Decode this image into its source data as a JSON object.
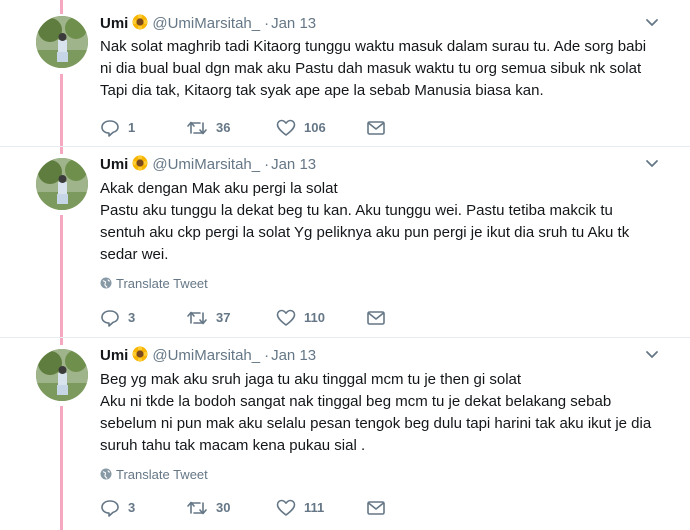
{
  "tweets": [
    {
      "name": "Umi",
      "handle": "@UmiMarsitah_",
      "sep": "·",
      "time": "Jan 13",
      "lines": [
        "Nak solat maghrib tadi Kitaorg tunggu waktu masuk dalam surau tu. Ade sorg babi ni dia bual bual dgn mak aku Pastu dah masuk waktu tu org semua sibuk nk solat Tapi dia tak, Kitaorg tak syak ape ape la sebab Manusia biasa kan."
      ],
      "translate": "",
      "replies": "1",
      "retweets": "36",
      "likes": "106"
    },
    {
      "name": "Umi",
      "handle": "@UmiMarsitah_",
      "sep": "·",
      "time": "Jan 13",
      "lines": [
        "Akak dengan Mak aku pergi la solat",
        "Pastu aku tunggu la dekat beg tu kan. Aku tunggu wei. Pastu tetiba makcik tu sentuh aku ckp pergi la solat Yg peliknya aku pun pergi je ikut dia sruh tu Aku tk sedar wei."
      ],
      "translate": "Translate Tweet",
      "replies": "3",
      "retweets": "37",
      "likes": "110"
    },
    {
      "name": "Umi",
      "handle": "@UmiMarsitah_",
      "sep": "·",
      "time": "Jan 13",
      "lines": [
        "Beg yg mak aku sruh jaga tu aku tinggal mcm tu je then gi solat",
        "Aku ni tkde la bodoh sangat nak tinggal beg mcm tu je dekat belakang sebab sebelum ni pun mak aku selalu pesan tengok beg dulu tapi harini tak aku ikut je dia suruh tahu tak macam kena pukau sial ."
      ],
      "translate": "Translate Tweet",
      "replies": "3",
      "retweets": "30",
      "likes": "111"
    }
  ],
  "colors": {
    "thread_line": "#f5a8bf",
    "muted": "#657786",
    "text": "#14171a",
    "divider": "#e6ecf0"
  },
  "icons": {
    "reply": "reply-icon",
    "retweet": "retweet-icon",
    "like": "heart-icon",
    "dm": "envelope-icon",
    "more": "chevron-down-icon",
    "translate": "globe-icon",
    "emoji": "sunflower-emoji"
  }
}
